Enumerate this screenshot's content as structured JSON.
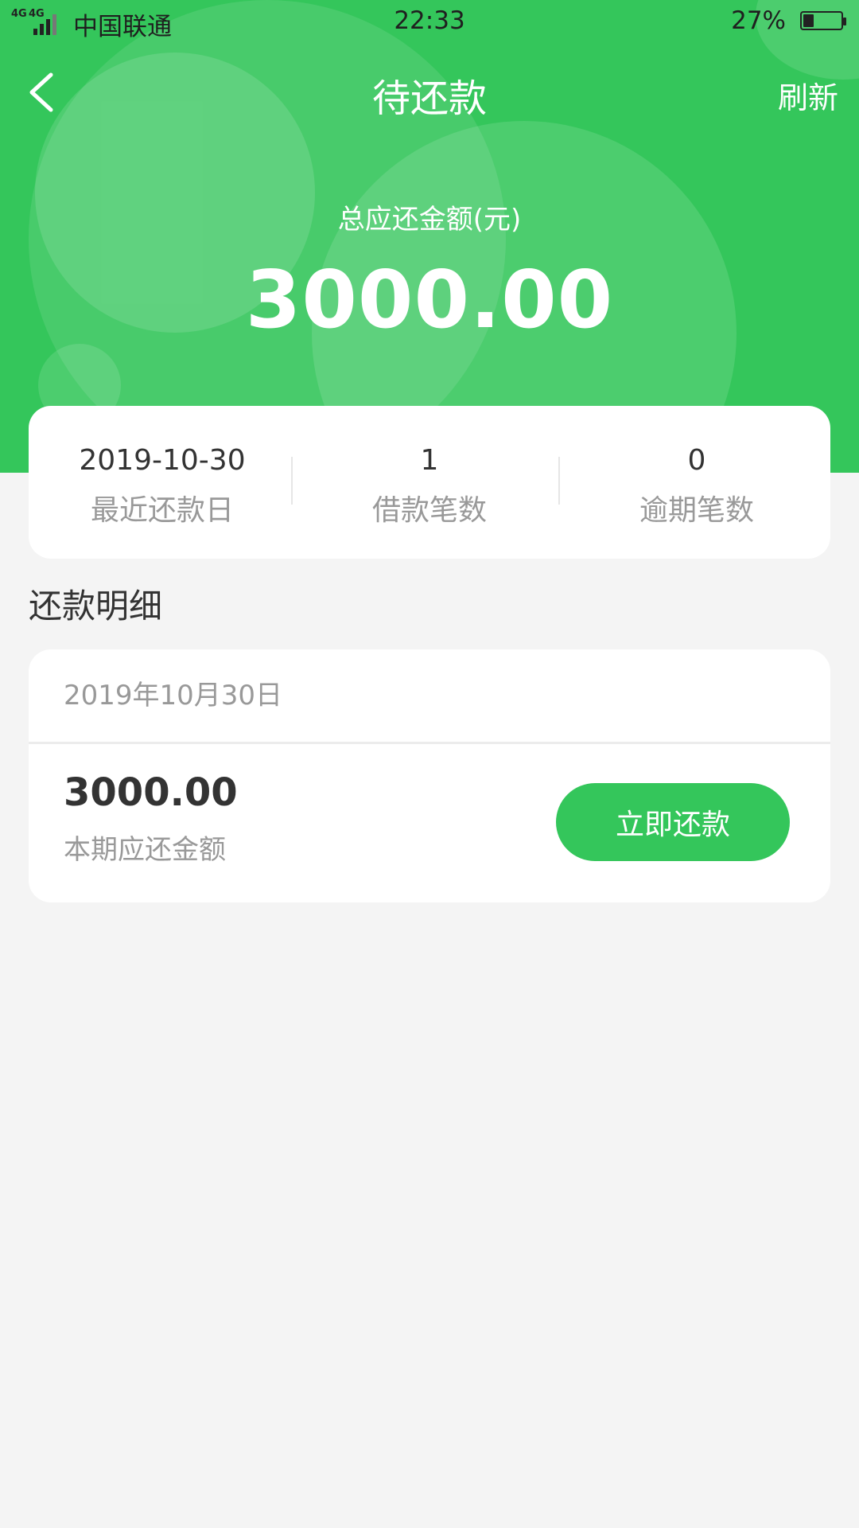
{
  "status_bar": {
    "network": "4G 4G",
    "carrier": "中国联通",
    "time": "22:33",
    "battery": "27%",
    "battery_level": 0.27
  },
  "nav": {
    "back_icon": "chevron-left-icon",
    "title": "待还款",
    "refresh_label": "刷新"
  },
  "summary": {
    "total_label": "总应还金额(元)",
    "total_amount": "3000.00"
  },
  "stats": [
    {
      "value": "2019-10-30",
      "label": "最近还款日"
    },
    {
      "value": "1",
      "label": "借款笔数"
    },
    {
      "value": "0",
      "label": "逾期笔数"
    }
  ],
  "section": {
    "title": "还款明细"
  },
  "detail": {
    "date": "2019年10月30日",
    "amount": "3000.00",
    "amount_label": "本期应还金额",
    "pay_button": "立即还款"
  },
  "colors": {
    "brand_green": "#34c65b",
    "background": "#f4f4f4"
  }
}
